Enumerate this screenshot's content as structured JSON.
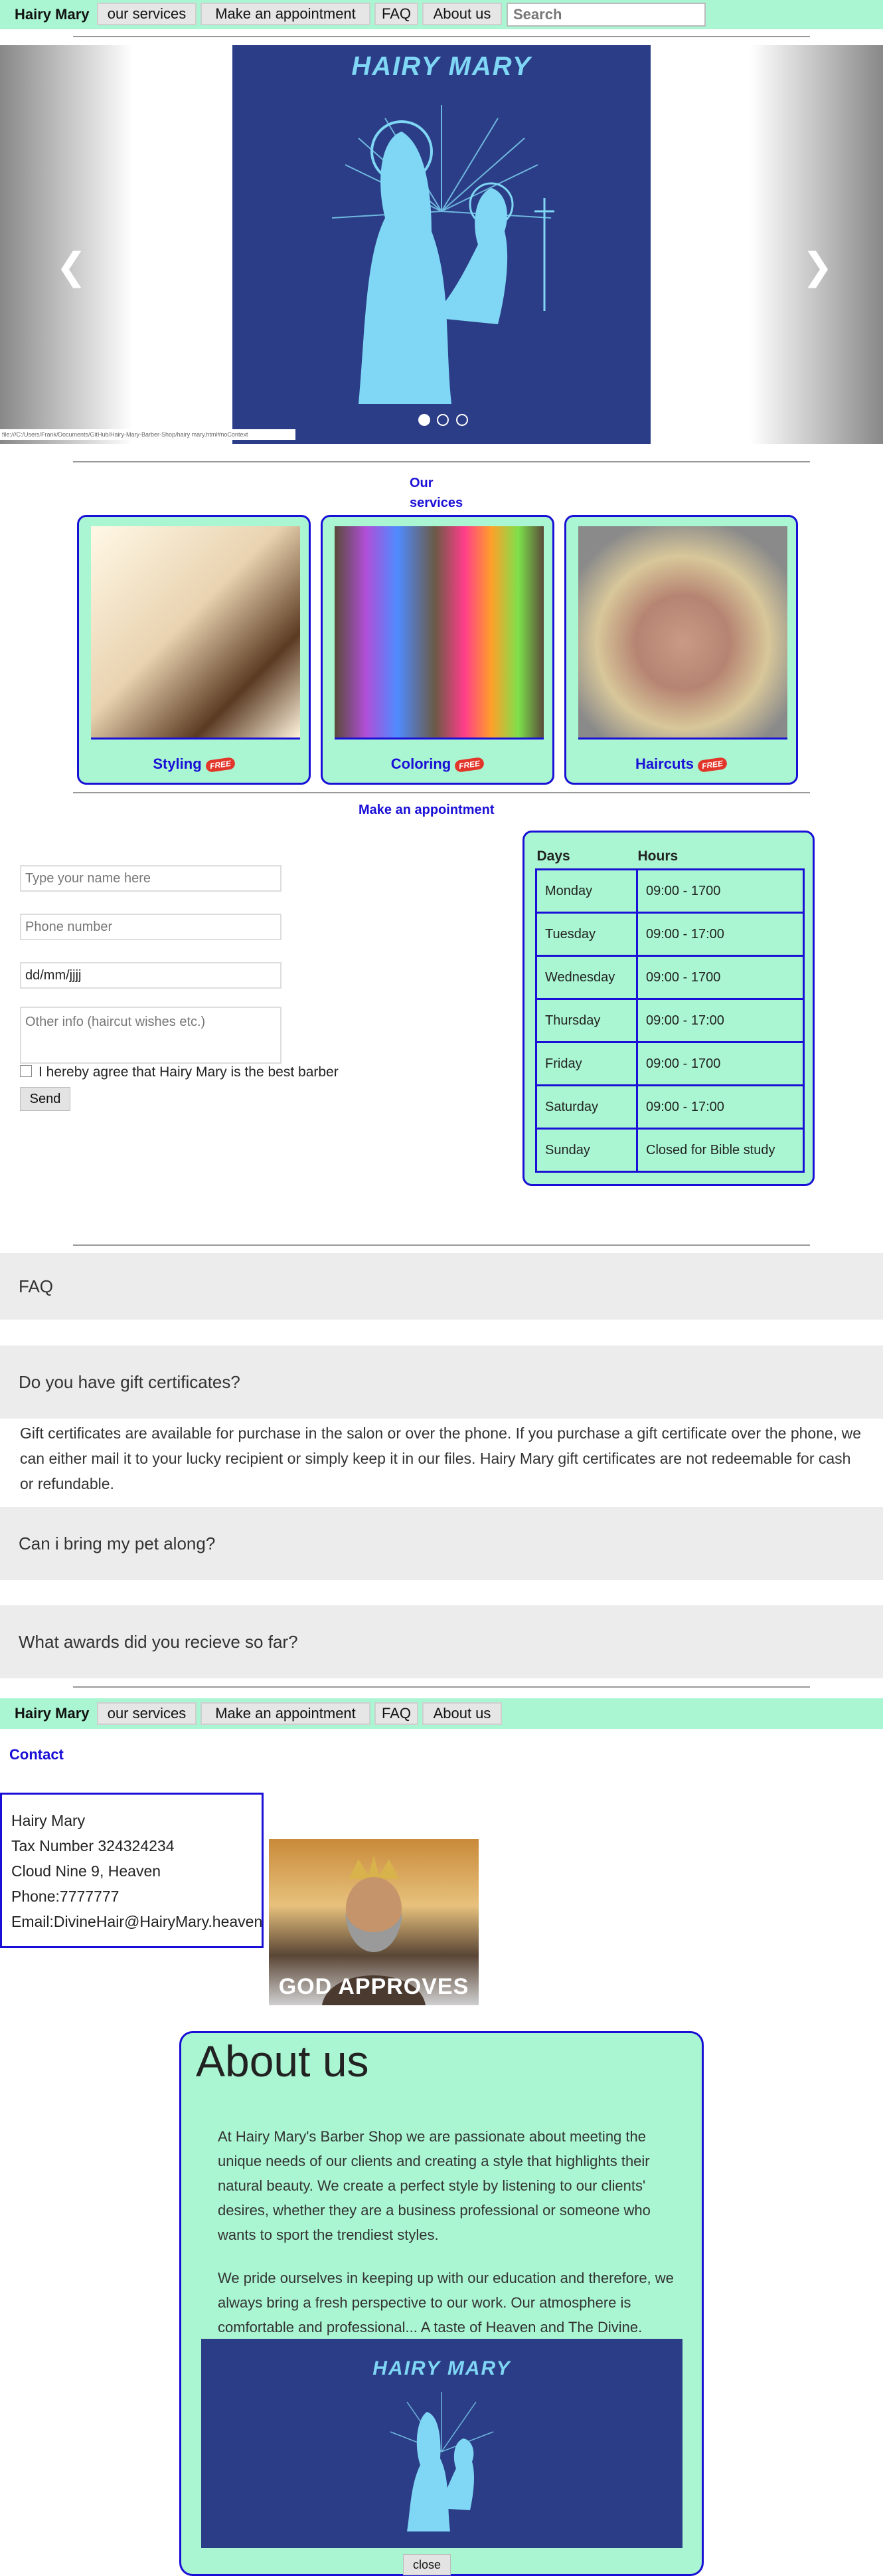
{
  "nav": {
    "brand": "Hairy Mary",
    "items": [
      "our services",
      "Make an appointment",
      "FAQ",
      "About us"
    ],
    "search_placeholder": "Search"
  },
  "hero": {
    "title": "HAIRY MARY",
    "path_label": "file:///C:/Users/Frank/Documents/GitHub/Hairy-Mary-Barber-Shop/hairy mary.html#noContext",
    "slides": 3,
    "active_slide": 1,
    "prev_icon": "chevron-left-icon",
    "next_icon": "chevron-right-icon"
  },
  "services": {
    "title": "Our services",
    "cards": [
      {
        "label": "Styling",
        "badge": "FREE"
      },
      {
        "label": "Coloring",
        "badge": "FREE"
      },
      {
        "label": "Haircuts",
        "badge": "FREE"
      }
    ]
  },
  "appointment": {
    "title": "Make an appointment",
    "name_placeholder": "Type your name here",
    "phone_placeholder": "Phone number",
    "date_placeholder": "dd/mm/jjjj",
    "other_placeholder": "Other info (haircut wishes etc.)",
    "agree_label": "I hereby agree that Hairy Mary is the best barber",
    "send_label": "Send"
  },
  "hours": {
    "headers": [
      "Days",
      "Hours"
    ],
    "rows": [
      [
        "Monday",
        "09:00 - 1700"
      ],
      [
        "Tuesday",
        "09:00 - 17:00"
      ],
      [
        "Wednesday",
        "09:00 - 1700"
      ],
      [
        "Thursday",
        "09:00 - 17:00"
      ],
      [
        "Friday",
        "09:00 - 1700"
      ],
      [
        "Saturday",
        "09:00 - 17:00"
      ],
      [
        "Sunday",
        "Closed for Bible study"
      ]
    ]
  },
  "faq": {
    "title": "FAQ",
    "q1": "Do you have gift certificates?",
    "a1": "Gift certificates are available for purchase in the salon or over the phone. If you purchase a gift certificate over the phone, we can either mail it to your lucky recipient or simply keep it in our files. Hairy Mary gift certificates are not redeemable for cash or refundable.",
    "q2": "Can i bring my pet along?",
    "q3": "What awards did you recieve so far?"
  },
  "contact": {
    "title": "Contact",
    "name": "Hairy Mary",
    "tax": "Tax Number 324324234",
    "address": "Cloud Nine 9, Heaven",
    "phone": "Phone:7777777",
    "email": "Email:DivineHair@HairyMary.heaven",
    "image_caption": "GOD APPROVES"
  },
  "about": {
    "title": "About us",
    "p1": "At Hairy Mary's Barber Shop we are passionate about meeting the unique needs of our clients and creating a style that highlights their natural beauty. We create a perfect style by listening to our clients' desires, whether they are a business professional or someone who wants to sport the trendiest styles.",
    "p2": "We pride ourselves in keeping up with our education and therefore, we always bring a fresh perspective to our work. Our atmosphere is comfortable and professional... A taste of Heaven and The Divine.",
    "image_title": "HAIRY MARY",
    "close_label": "close"
  },
  "colors": {
    "mint": "#aaf6d2",
    "accent_blue": "#1a0fd6",
    "navy": "#2b3d86",
    "light_blue": "#7fd6f5"
  }
}
